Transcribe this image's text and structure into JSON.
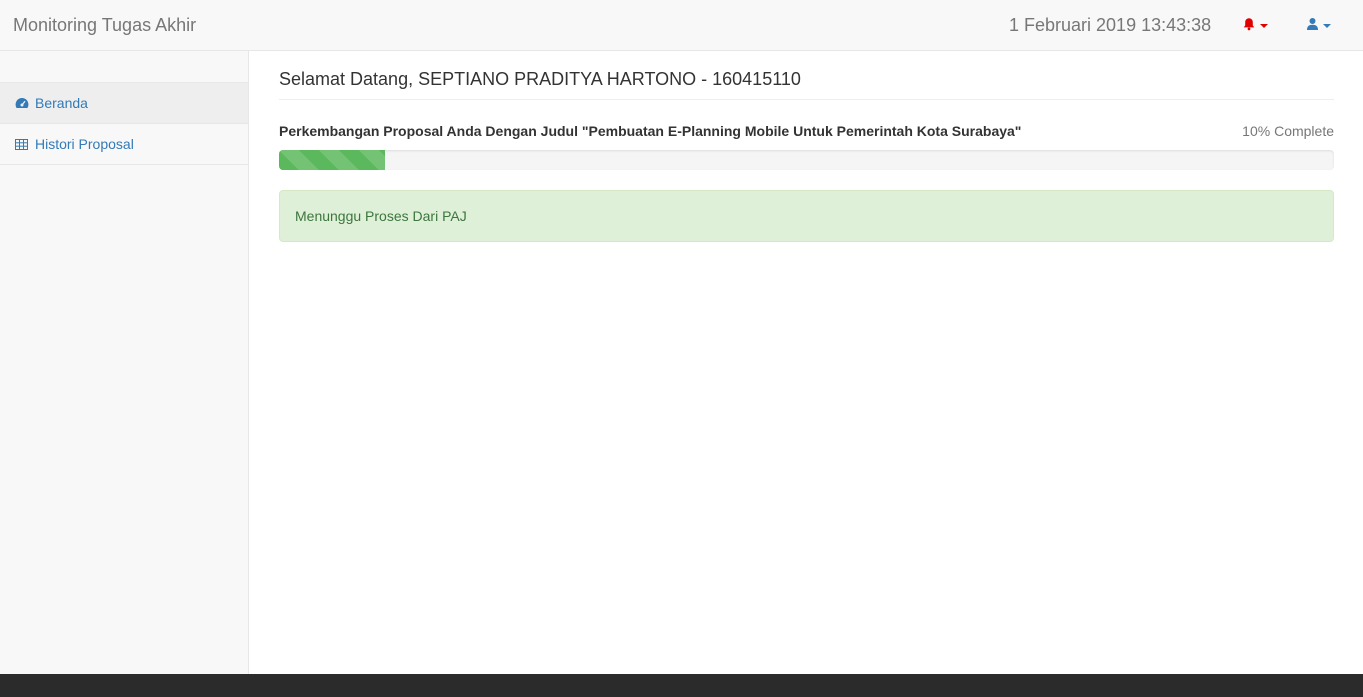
{
  "app": {
    "brand": "Monitoring Tugas Akhir",
    "datetime": "1 Februari 2019 13:43:38"
  },
  "navbar": {
    "notifications_icon": "bell-icon",
    "user_icon": "user-icon",
    "accent_bell": "#e00000",
    "accent_user": "#337ab7"
  },
  "sidebar": {
    "items": [
      {
        "label": "Beranda",
        "icon": "dashboard-icon",
        "active": true
      },
      {
        "label": "Histori Proposal",
        "icon": "table-icon",
        "active": false
      }
    ]
  },
  "main": {
    "welcome": "Selamat Datang, SEPTIANO PRADITYA HARTONO - 160415110",
    "progress": {
      "title": "Perkembangan Proposal Anda Dengan Judul \"Pembuatan E-Planning Mobile Untuk Pemerintah Kota Surabaya\"",
      "percent_label": "10% Complete",
      "value_percent": 10,
      "color": "#5cb85c"
    },
    "status_message": "Menunggu Proses Dari PAJ"
  }
}
